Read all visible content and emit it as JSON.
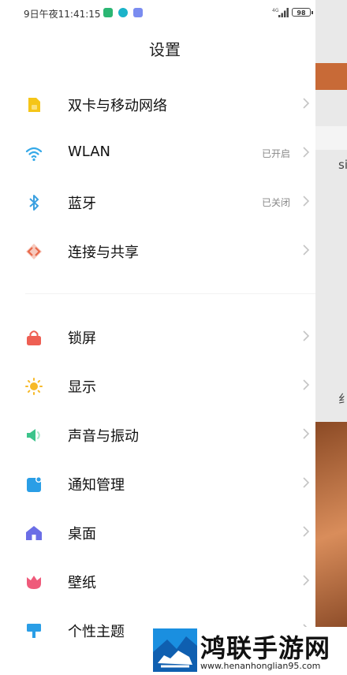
{
  "status_bar": {
    "time": "9日午夜11:41:15",
    "battery": "98"
  },
  "page": {
    "title": "设置"
  },
  "section1": [
    {
      "label": "双卡与移动网络",
      "value": "",
      "icon": "sim-card-icon",
      "color": "#f5c518"
    },
    {
      "label": "WLAN",
      "value": "已开启",
      "icon": "wifi-icon",
      "color": "#35a9e8"
    },
    {
      "label": "蓝牙",
      "value": "已关闭",
      "icon": "bluetooth-icon",
      "color": "#3aa0e0"
    },
    {
      "label": "连接与共享",
      "value": "",
      "icon": "share-icon",
      "color": "#e8694a"
    }
  ],
  "section2": [
    {
      "label": "锁屏",
      "icon": "lock-icon",
      "color": "#ee5f53"
    },
    {
      "label": "显示",
      "icon": "sun-icon",
      "color": "#f7b928"
    },
    {
      "label": "声音与振动",
      "icon": "speaker-icon",
      "color": "#3cc48b"
    },
    {
      "label": "通知管理",
      "icon": "notification-icon",
      "color": "#2a9ee6"
    },
    {
      "label": "桌面",
      "icon": "home-icon",
      "color": "#6b6ee6"
    },
    {
      "label": "壁纸",
      "icon": "tulip-icon",
      "color": "#ef5a7a"
    },
    {
      "label": "个性主题",
      "icon": "brush-icon",
      "color": "#2a9ee6"
    }
  ],
  "watermark": {
    "brand": "鸿联手游网",
    "url": "www.henanhonglian95.com"
  },
  "background": {
    "peek_text_1": "si",
    "peek_text_2": "纟"
  }
}
